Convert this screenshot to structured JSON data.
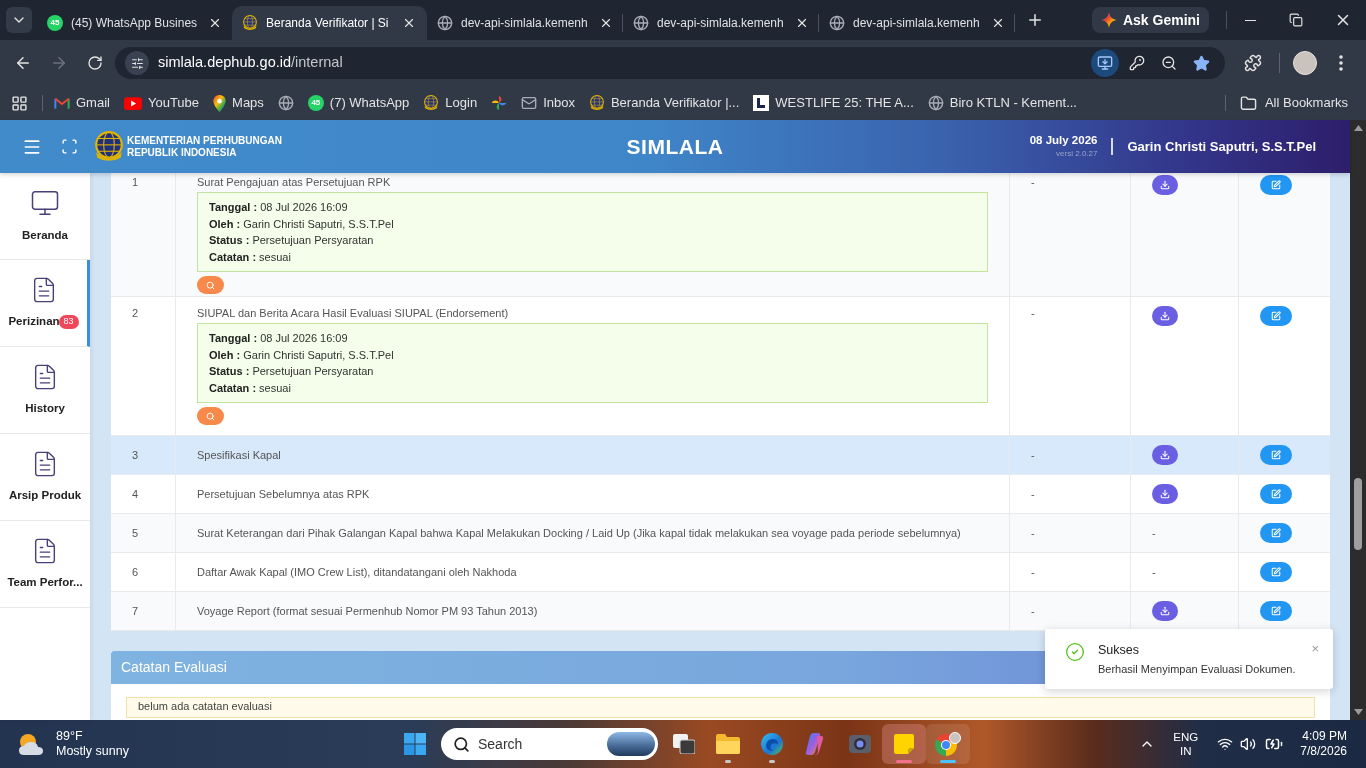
{
  "browser": {
    "tabs": [
      {
        "title": "(45) WhatsApp Busines",
        "kind": "badge",
        "badge": "45",
        "selected": false
      },
      {
        "title": "Beranda Verifikator | Si",
        "kind": "emblem",
        "selected": true
      },
      {
        "title": "dev-api-simlala.kemenh",
        "kind": "globe",
        "selected": false
      },
      {
        "title": "dev-api-simlala.kemenh",
        "kind": "globe",
        "selected": false
      },
      {
        "title": "dev-api-simlala.kemenh",
        "kind": "globe",
        "selected": false
      }
    ],
    "ask_button": "Ask Gemini",
    "forward_disabled": true,
    "address": {
      "host": "simlala.dephub.go.id",
      "path": "/internal"
    },
    "bookmarked": true,
    "bookmarks": [
      {
        "kind": "mail",
        "label": "Gmail"
      },
      {
        "kind": "play",
        "label": "YouTube"
      },
      {
        "kind": "pin",
        "label": "Maps"
      },
      {
        "kind": "globe"
      },
      {
        "kind": "badge",
        "badge": "45",
        "label": "(7) WhatsApp"
      },
      {
        "kind": "emblem",
        "label": "Login"
      },
      {
        "kind": "pinwheel"
      },
      {
        "kind": "envelope",
        "label": "Inbox"
      },
      {
        "kind": "emblem",
        "label": "Beranda Verifikator |..."
      },
      {
        "kind": "square",
        "label": "WESTLIFE 25: THE A..."
      },
      {
        "kind": "globe",
        "label": "Biro KTLN - Kement..."
      }
    ],
    "all_bookmarks": "All Bookmarks"
  },
  "header": {
    "org_lines": [
      "KEMENTERIAN PERHUBUNGAN",
      "REPUBLIK INDONESIA"
    ],
    "title": "SIMLALA",
    "date": "08 July 2026",
    "version": "versi 2.0.27",
    "user": "Garin Christi Saputri, S.S.T.Pel"
  },
  "sidebar": {
    "items": [
      {
        "label": "Beranda",
        "kind": "monitor",
        "selected": false
      },
      {
        "label": "Perizinan",
        "kind": "document",
        "badge": "83",
        "selected": true
      },
      {
        "label": "History",
        "kind": "document",
        "selected": false
      },
      {
        "label": "Arsip Produk",
        "kind": "document",
        "selected": false
      },
      {
        "label": "Team Perfor...",
        "kind": "document",
        "selected": false
      }
    ]
  },
  "table": {
    "rows": [
      {
        "no": "1",
        "name": "Surat Pengajuan atas Persetujuan RPK",
        "evaluation": [
          "**Tanggal :** 08 Jul 2026 16:09",
          "**Oleh :** Garin Christi Saputri, S.S.T.Pel",
          "**Status :** Persetujuan Persyaratan",
          "**Catatan :** sesuai"
        ],
        "column_3": "-",
        "download": true,
        "highlighted": false
      },
      {
        "no": "2",
        "name": "SIUPAL dan Berita Acara Hasil Evaluasi SIUPAL (Endorsement)",
        "evaluation": [
          "**Tanggal :** 08 Jul 2026 16:09",
          "**Oleh :** Garin Christi Saputri, S.S.T.Pel",
          "**Status :** Persetujuan Persyaratan",
          "**Catatan :** sesuai"
        ],
        "column_3": "-",
        "download": true,
        "highlighted": false
      },
      {
        "no": "3",
        "name": "Spesifikasi Kapal",
        "column_3": "-",
        "download": true,
        "highlighted": true
      },
      {
        "no": "4",
        "name": "Persetujuan Sebelumnya atas RPK",
        "column_3": "-",
        "download": true,
        "highlighted": false
      },
      {
        "no": "5",
        "name": "Surat Keterangan dari Pihak Galangan Kapal bahwa Kapal Melakukan Docking / Laid Up (Jika kapal tidak melakukan sea voyage pada periode sebelumnya)",
        "column_3": "-",
        "download": false,
        "column_4": "-",
        "highlighted": false
      },
      {
        "no": "6",
        "name": "Daftar Awak Kapal (IMO Crew List), ditandatangani oleh Nakhoda",
        "column_3": "-",
        "download": false,
        "column_4": "-",
        "highlighted": false
      },
      {
        "no": "7",
        "name": "Voyage Report (format sesuai Permenhub Nomor PM 93 Tahun 2013)",
        "column_3": "-",
        "download": true,
        "highlighted": false
      }
    ]
  },
  "evaluation_notes": {
    "title": "Catatan Evaluasi",
    "note": "belum ada catatan evaluasi"
  },
  "toast": {
    "title": "Sukses",
    "message": "Berhasil Menyimpan Evaluasi Dokumen.",
    "close": "×"
  },
  "taskbar": {
    "weather": {
      "temperature": "89°F",
      "condition": "Mostly sunny"
    },
    "search": {
      "placeholder": "Search"
    },
    "apps": [
      {
        "kind": "task-view",
        "running": false,
        "active": false,
        "flashing": false
      },
      {
        "kind": "folder",
        "running": true,
        "active": false,
        "flashing": false
      },
      {
        "kind": "edge",
        "running": true,
        "active": false,
        "flashing": false
      },
      {
        "kind": "copilot",
        "running": false,
        "active": false,
        "flashing": false
      },
      {
        "kind": "camera",
        "running": false,
        "active": false,
        "flashing": false
      },
      {
        "kind": "notes",
        "running": true,
        "active": false,
        "flashing": true
      },
      {
        "kind": "chrome",
        "running": true,
        "active": true,
        "flashing": false
      }
    ],
    "language": [
      "ENG",
      "IN"
    ],
    "time": "4:09 PM",
    "date": "7/8/2026"
  }
}
